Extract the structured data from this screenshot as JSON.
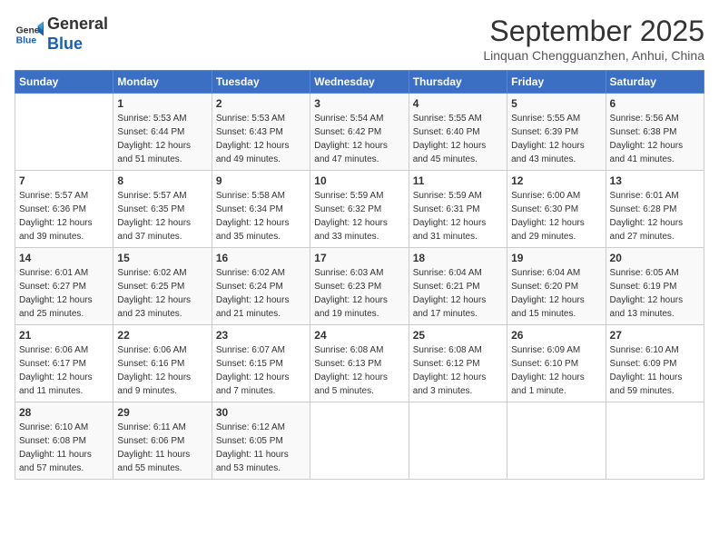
{
  "header": {
    "logo_line1": "General",
    "logo_line2": "Blue",
    "month_title": "September 2025",
    "location": "Linquan Chengguanzhen, Anhui, China"
  },
  "days_of_week": [
    "Sunday",
    "Monday",
    "Tuesday",
    "Wednesday",
    "Thursday",
    "Friday",
    "Saturday"
  ],
  "weeks": [
    [
      {
        "day": "",
        "info": ""
      },
      {
        "day": "1",
        "info": "Sunrise: 5:53 AM\nSunset: 6:44 PM\nDaylight: 12 hours\nand 51 minutes."
      },
      {
        "day": "2",
        "info": "Sunrise: 5:53 AM\nSunset: 6:43 PM\nDaylight: 12 hours\nand 49 minutes."
      },
      {
        "day": "3",
        "info": "Sunrise: 5:54 AM\nSunset: 6:42 PM\nDaylight: 12 hours\nand 47 minutes."
      },
      {
        "day": "4",
        "info": "Sunrise: 5:55 AM\nSunset: 6:40 PM\nDaylight: 12 hours\nand 45 minutes."
      },
      {
        "day": "5",
        "info": "Sunrise: 5:55 AM\nSunset: 6:39 PM\nDaylight: 12 hours\nand 43 minutes."
      },
      {
        "day": "6",
        "info": "Sunrise: 5:56 AM\nSunset: 6:38 PM\nDaylight: 12 hours\nand 41 minutes."
      }
    ],
    [
      {
        "day": "7",
        "info": "Sunrise: 5:57 AM\nSunset: 6:36 PM\nDaylight: 12 hours\nand 39 minutes."
      },
      {
        "day": "8",
        "info": "Sunrise: 5:57 AM\nSunset: 6:35 PM\nDaylight: 12 hours\nand 37 minutes."
      },
      {
        "day": "9",
        "info": "Sunrise: 5:58 AM\nSunset: 6:34 PM\nDaylight: 12 hours\nand 35 minutes."
      },
      {
        "day": "10",
        "info": "Sunrise: 5:59 AM\nSunset: 6:32 PM\nDaylight: 12 hours\nand 33 minutes."
      },
      {
        "day": "11",
        "info": "Sunrise: 5:59 AM\nSunset: 6:31 PM\nDaylight: 12 hours\nand 31 minutes."
      },
      {
        "day": "12",
        "info": "Sunrise: 6:00 AM\nSunset: 6:30 PM\nDaylight: 12 hours\nand 29 minutes."
      },
      {
        "day": "13",
        "info": "Sunrise: 6:01 AM\nSunset: 6:28 PM\nDaylight: 12 hours\nand 27 minutes."
      }
    ],
    [
      {
        "day": "14",
        "info": "Sunrise: 6:01 AM\nSunset: 6:27 PM\nDaylight: 12 hours\nand 25 minutes."
      },
      {
        "day": "15",
        "info": "Sunrise: 6:02 AM\nSunset: 6:25 PM\nDaylight: 12 hours\nand 23 minutes."
      },
      {
        "day": "16",
        "info": "Sunrise: 6:02 AM\nSunset: 6:24 PM\nDaylight: 12 hours\nand 21 minutes."
      },
      {
        "day": "17",
        "info": "Sunrise: 6:03 AM\nSunset: 6:23 PM\nDaylight: 12 hours\nand 19 minutes."
      },
      {
        "day": "18",
        "info": "Sunrise: 6:04 AM\nSunset: 6:21 PM\nDaylight: 12 hours\nand 17 minutes."
      },
      {
        "day": "19",
        "info": "Sunrise: 6:04 AM\nSunset: 6:20 PM\nDaylight: 12 hours\nand 15 minutes."
      },
      {
        "day": "20",
        "info": "Sunrise: 6:05 AM\nSunset: 6:19 PM\nDaylight: 12 hours\nand 13 minutes."
      }
    ],
    [
      {
        "day": "21",
        "info": "Sunrise: 6:06 AM\nSunset: 6:17 PM\nDaylight: 12 hours\nand 11 minutes."
      },
      {
        "day": "22",
        "info": "Sunrise: 6:06 AM\nSunset: 6:16 PM\nDaylight: 12 hours\nand 9 minutes."
      },
      {
        "day": "23",
        "info": "Sunrise: 6:07 AM\nSunset: 6:15 PM\nDaylight: 12 hours\nand 7 minutes."
      },
      {
        "day": "24",
        "info": "Sunrise: 6:08 AM\nSunset: 6:13 PM\nDaylight: 12 hours\nand 5 minutes."
      },
      {
        "day": "25",
        "info": "Sunrise: 6:08 AM\nSunset: 6:12 PM\nDaylight: 12 hours\nand 3 minutes."
      },
      {
        "day": "26",
        "info": "Sunrise: 6:09 AM\nSunset: 6:10 PM\nDaylight: 12 hours\nand 1 minute."
      },
      {
        "day": "27",
        "info": "Sunrise: 6:10 AM\nSunset: 6:09 PM\nDaylight: 11 hours\nand 59 minutes."
      }
    ],
    [
      {
        "day": "28",
        "info": "Sunrise: 6:10 AM\nSunset: 6:08 PM\nDaylight: 11 hours\nand 57 minutes."
      },
      {
        "day": "29",
        "info": "Sunrise: 6:11 AM\nSunset: 6:06 PM\nDaylight: 11 hours\nand 55 minutes."
      },
      {
        "day": "30",
        "info": "Sunrise: 6:12 AM\nSunset: 6:05 PM\nDaylight: 11 hours\nand 53 minutes."
      },
      {
        "day": "",
        "info": ""
      },
      {
        "day": "",
        "info": ""
      },
      {
        "day": "",
        "info": ""
      },
      {
        "day": "",
        "info": ""
      }
    ]
  ]
}
